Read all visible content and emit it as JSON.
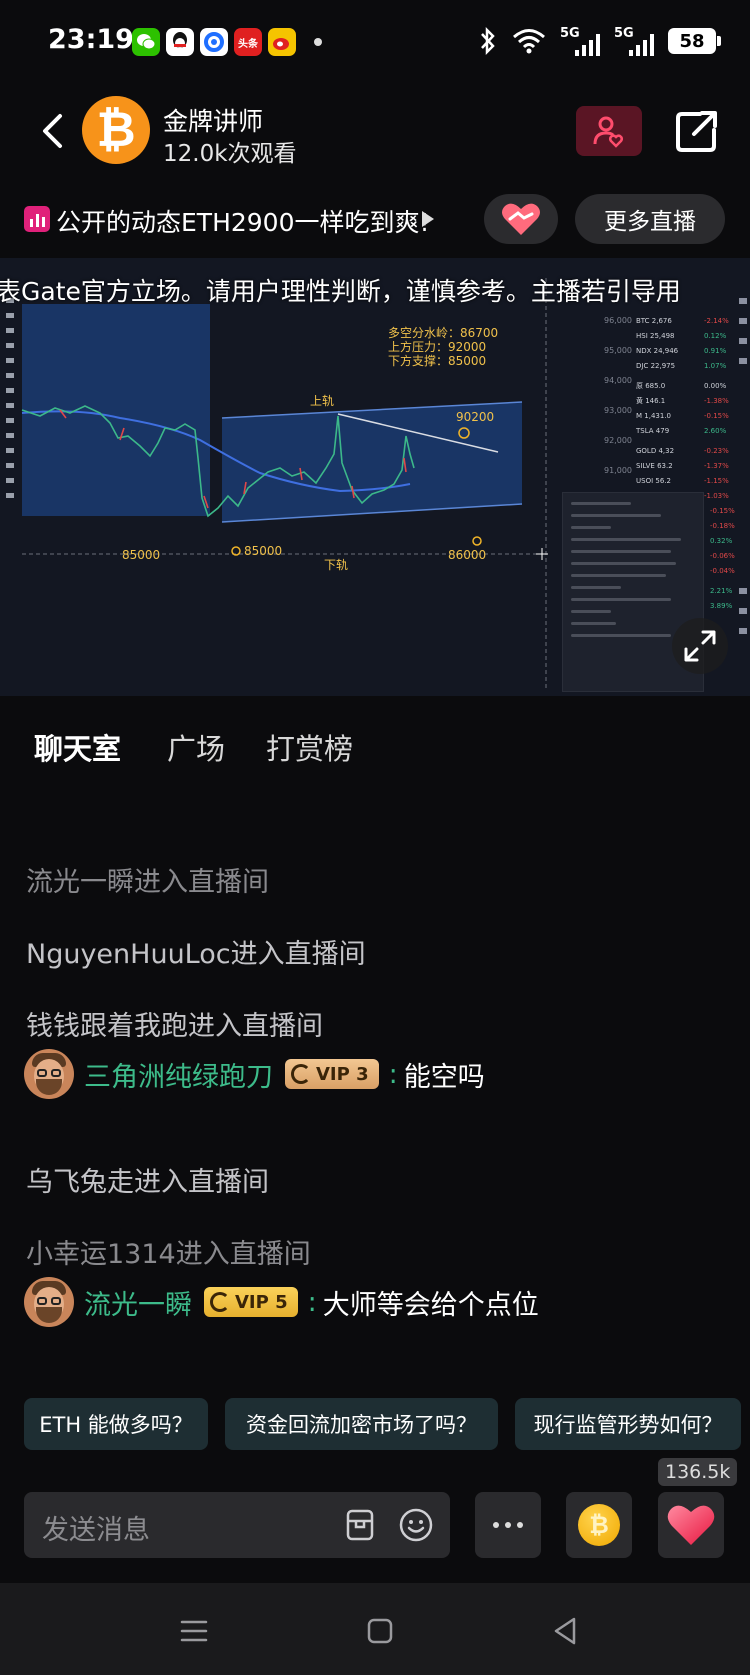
{
  "status_bar": {
    "time": "23:19",
    "app_icons": [
      {
        "name": "wechat-icon",
        "color": "#2dc100",
        "glyph": "●"
      },
      {
        "name": "qq-icon",
        "color": "#1d1d1d",
        "glyph": "Q"
      },
      {
        "name": "browser-icon",
        "color": "#1f6fff",
        "glyph": "C"
      },
      {
        "name": "toutiao-icon",
        "color": "#e02020",
        "glyph": "头条"
      },
      {
        "name": "weibo-icon",
        "color": "#f5b400",
        "glyph": "微"
      }
    ],
    "sim1": "5G",
    "sim2": "5G",
    "battery": "58"
  },
  "header": {
    "anchor_name": "金牌讲师",
    "viewers": "12.0k次观看"
  },
  "marquee": {
    "text": "公开的动态ETH2900一样吃到爽!",
    "more_live_label": "更多直播"
  },
  "video": {
    "disclaimer": "表Gate官方立场。请用户理性判断，谨慎参考。主播若引导用",
    "annotations": {
      "line1": "多空分水岭：86700",
      "line2": "上方压力：92000",
      "line3": "下方支撑：85000",
      "upper_rail": "上轨",
      "lower_rail": "下轨",
      "p90200": "90200",
      "p85000a": "85000",
      "p85000b": "85000",
      "p86000": "86000"
    }
  },
  "tabs": [
    {
      "label": "聊天室",
      "active": true
    },
    {
      "label": "广场",
      "active": false
    },
    {
      "label": "打赏榜",
      "active": false
    }
  ],
  "chat": {
    "messages": [
      {
        "type": "system",
        "text": "流光一瞬进入直播间"
      },
      {
        "type": "system",
        "text": "NguyenHuuLoc进入直播间"
      },
      {
        "type": "system",
        "text": "钱钱跟着我跑进入直播间"
      },
      {
        "type": "user",
        "name": "三角洲纯绿跑刀",
        "vip": "VIP 3",
        "text": "能空吗"
      },
      {
        "type": "system",
        "text": "乌飞兔走进入直播间"
      },
      {
        "type": "system",
        "text": "小幸运1314进入直播间"
      },
      {
        "type": "user",
        "name": "流光一瞬",
        "vip": "VIP 5",
        "text": "大师等会给个点位"
      }
    ],
    "colon": ":"
  },
  "quick_questions": [
    "ETH 能做多吗？",
    "资金回流加密市场了吗？",
    "现行监管形势如何？"
  ],
  "input": {
    "placeholder": "发送消息",
    "like_count": "136.5k"
  },
  "colors": {
    "accent_green": "#3dbb8a",
    "vip3_gold": "#e6b77a",
    "vip5_gold": "#f0c14b",
    "chart_blue": "#1f4e9c"
  }
}
